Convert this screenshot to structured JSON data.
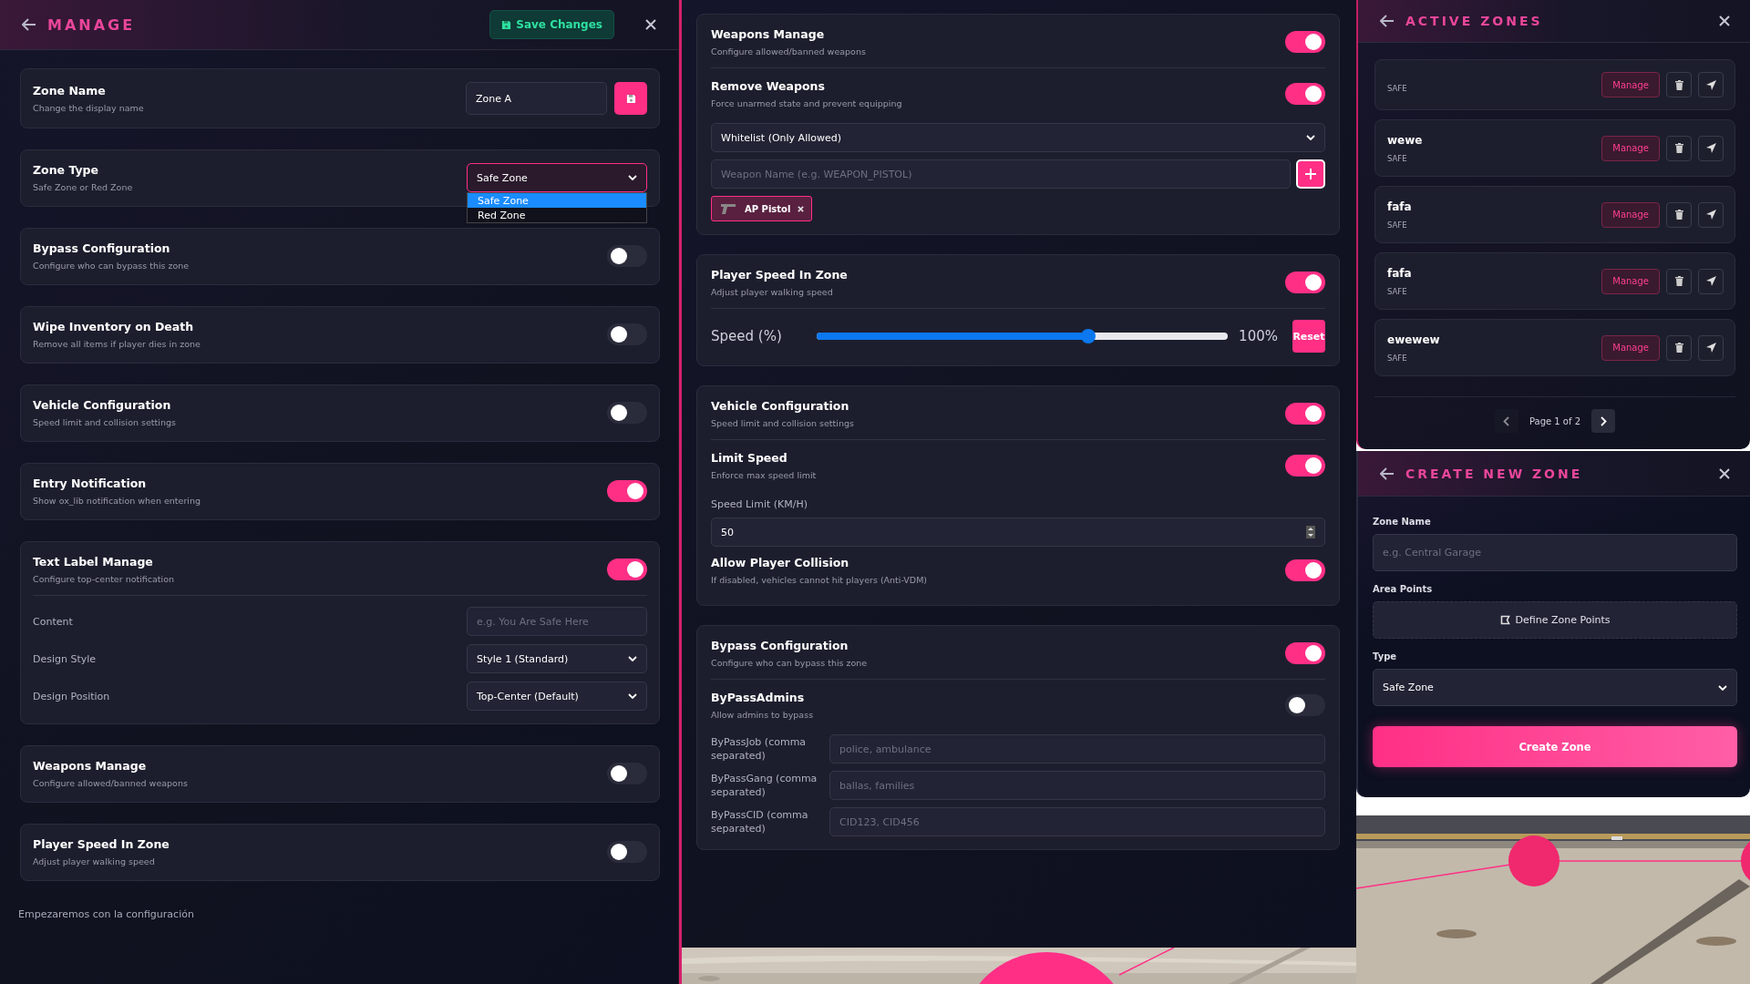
{
  "manage": {
    "title": "MANAGE",
    "save_button": "Save Changes",
    "sections": [
      {
        "kind": "input",
        "title": "Zone Name",
        "subtitle": "Change the display name",
        "value": "Zone A"
      },
      {
        "kind": "select",
        "title": "Zone Type",
        "subtitle": "Safe Zone or Red Zone",
        "value": "Safe Zone",
        "options": [
          {
            "label": "Safe Zone",
            "selected": true
          },
          {
            "label": "Red Zone",
            "selected": false
          }
        ]
      },
      {
        "kind": "toggle",
        "title": "Bypass Configuration",
        "subtitle": "Configure who can bypass this zone",
        "on": false
      },
      {
        "kind": "toggle",
        "title": "Wipe Inventory on Death",
        "subtitle": "Remove all items if player dies in zone",
        "on": false
      },
      {
        "kind": "toggle",
        "title": "Vehicle Configuration",
        "subtitle": "Speed limit and collision settings",
        "on": false
      },
      {
        "kind": "toggle",
        "title": "Entry Notification",
        "subtitle": "Show ox_lib notification when entering",
        "on": true
      },
      {
        "kind": "toggle",
        "title": "Text Label Manage",
        "subtitle": "Configure top-center notification",
        "on": true,
        "fields": [
          {
            "kind": "input",
            "label": "Content",
            "placeholder": "e.g. You Are Safe Here"
          },
          {
            "kind": "select",
            "label": "Design Style",
            "value": "Style 1 (Standard)"
          },
          {
            "kind": "select",
            "label": "Design Position",
            "value": "Top-Center (Default)"
          }
        ]
      },
      {
        "kind": "toggle",
        "title": "Weapons Manage",
        "subtitle": "Configure allowed/banned weapons",
        "on": false
      },
      {
        "kind": "toggle",
        "title": "Player Speed In Zone",
        "subtitle": "Adjust player walking speed",
        "on": false
      }
    ],
    "footer": "Empezaremos con la configuración"
  },
  "config": {
    "cards": [
      {
        "rows": [
          {
            "kind": "toggle",
            "title": "Weapons Manage",
            "subtitle": "Configure allowed/banned weapons",
            "on": true
          },
          {
            "kind": "toggle",
            "title": "Remove Weapons",
            "subtitle": "Force unarmed state and prevent equipping",
            "on": true
          },
          {
            "kind": "select",
            "value": "Whitelist (Only Allowed)"
          },
          {
            "kind": "add_input",
            "placeholder": "Weapon Name (e.g. WEAPON_PISTOL)"
          },
          {
            "kind": "tags",
            "tags": [
              {
                "label": "AP Pistol"
              }
            ]
          }
        ]
      },
      {
        "rows": [
          {
            "kind": "toggle",
            "title": "Player Speed In Zone",
            "subtitle": "Adjust player walking speed",
            "on": true
          },
          {
            "kind": "slider",
            "label": "Speed (%)",
            "level": 0.66,
            "reading": "100%",
            "button": "Reset"
          }
        ]
      },
      {
        "rows": [
          {
            "kind": "toggle",
            "title": "Vehicle Configuration",
            "subtitle": "Speed limit and collision settings",
            "on": true
          },
          {
            "kind": "toggle",
            "title": "Limit Speed",
            "subtitle": "Enforce max speed limit",
            "on": true
          },
          {
            "kind": "number",
            "label": "Speed Limit (KM/H)",
            "value": "50"
          },
          {
            "kind": "toggle",
            "title": "Allow Player Collision",
            "subtitle": "If disabled, vehicles cannot hit players (Anti-VDM)",
            "on": true
          }
        ]
      },
      {
        "rows": [
          {
            "kind": "toggle",
            "title": "Bypass Configuration",
            "subtitle": "Configure who can bypass this zone",
            "on": true
          },
          {
            "kind": "toggle",
            "title": "ByPassAdmins",
            "subtitle": "Allow admins to bypass",
            "on": false
          },
          {
            "kind": "text_input",
            "label": "ByPassJob (comma separated)",
            "placeholder": "police, ambulance"
          },
          {
            "kind": "text_input",
            "label": "ByPassGang (comma separated)",
            "placeholder": "ballas, families"
          },
          {
            "kind": "text_input",
            "label": "ByPassCID (comma separated)",
            "placeholder": "CID123, CID456"
          }
        ]
      }
    ]
  },
  "active_zones": {
    "title": "ACTIVE ZONES",
    "zones": [
      {
        "type": "SAFE",
        "button": "Manage"
      },
      {
        "name": "wewe",
        "type": "SAFE",
        "button": "Manage"
      },
      {
        "name": "fafa",
        "type": "SAFE",
        "button": "Manage"
      },
      {
        "name": "fafa",
        "type": "SAFE",
        "button": "Manage"
      },
      {
        "name": "ewewew",
        "type": "SAFE",
        "button": "Manage"
      }
    ],
    "pagination": {
      "text": "Page 1 of 2",
      "prev": {
        "disabled": true
      },
      "next": {
        "disabled": false
      }
    }
  },
  "create_zone": {
    "title": "CREATE NEW ZONE",
    "name_label": "Zone Name",
    "name_placeholder": "e.g. Central Garage",
    "points_label": "Area Points",
    "points_button": "Define Zone Points",
    "type_label": "Type",
    "type_value": "Safe Zone",
    "create_button": "Create Zone"
  }
}
